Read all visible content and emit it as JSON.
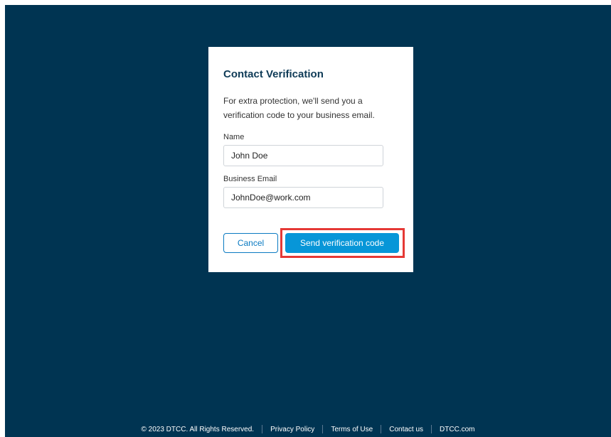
{
  "dialog": {
    "title": "Contact Verification",
    "description": "For extra protection, we'll send you a verification code to your business email.",
    "name_label": "Name",
    "name_value": "John Doe",
    "email_label": "Business Email",
    "email_value": "JohnDoe@work.com",
    "cancel_label": "Cancel",
    "send_label": "Send verification code"
  },
  "footer": {
    "copyright": "© 2023 DTCC. All Rights Reserved.",
    "privacy": "Privacy Policy",
    "terms": "Terms of Use",
    "contact": "Contact us",
    "site": "DTCC.com"
  },
  "colors": {
    "background": "#003452",
    "primary_button": "#0796d8",
    "highlight_border": "#e53935"
  }
}
